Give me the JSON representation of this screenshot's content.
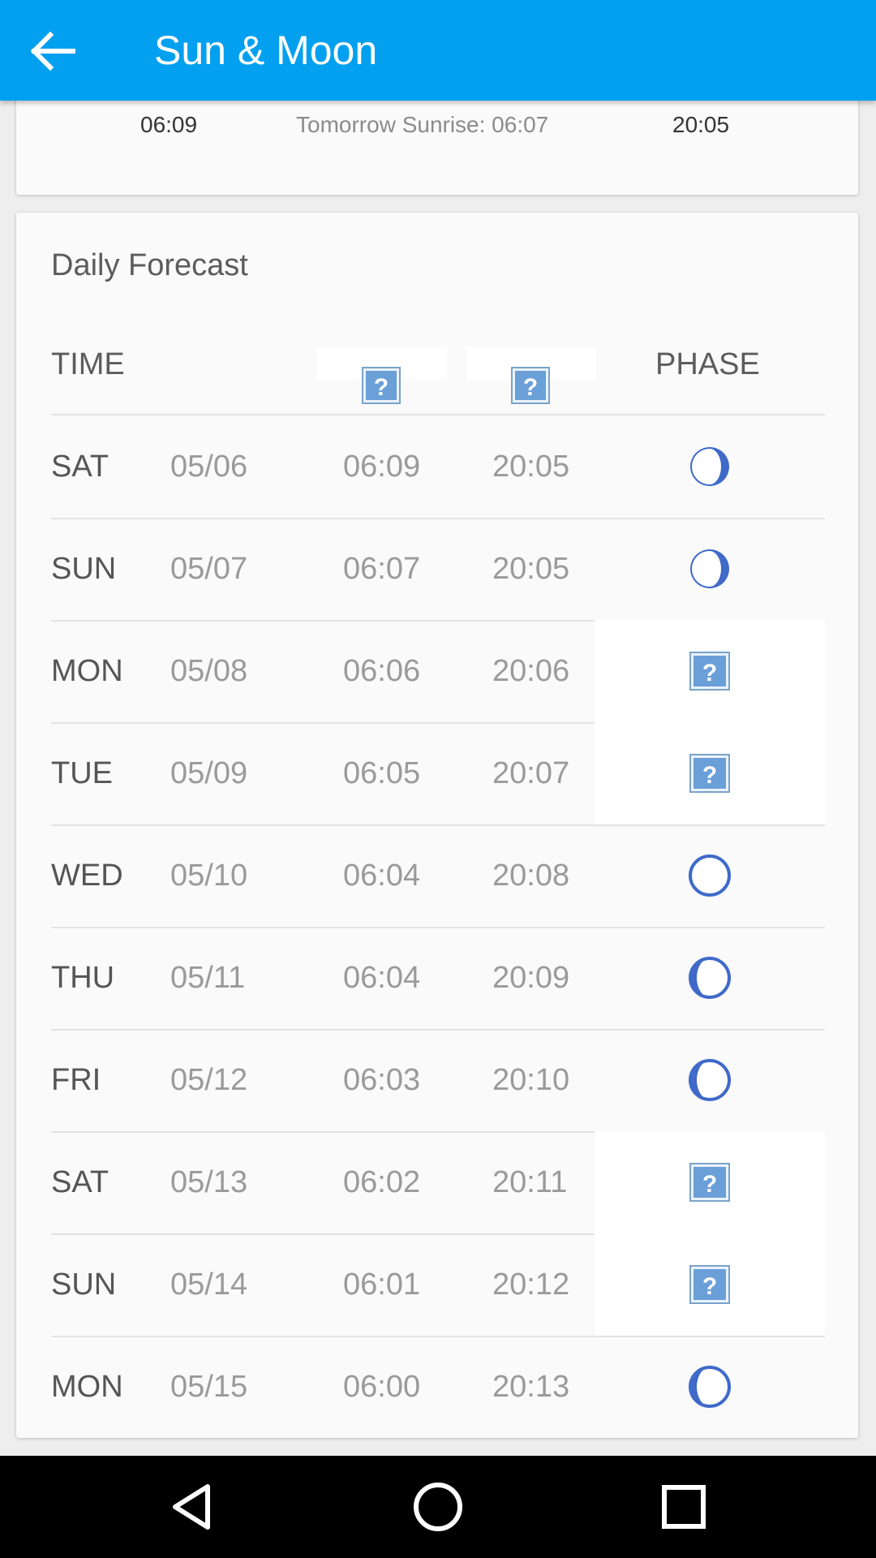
{
  "appbar": {
    "title": "Sun & Moon",
    "back_icon": "arrow-left-icon",
    "color": "#03a0ef"
  },
  "summary": {
    "sunrise": "06:09",
    "tomorrow": "Tomorrow Sunrise: 06:07",
    "sunset": "20:05"
  },
  "forecast": {
    "title": "Daily Forecast",
    "header": {
      "time": "TIME",
      "sunrise_icon": "missing-image-icon",
      "sunset_icon": "missing-image-icon",
      "phase": "PHASE"
    },
    "rows": [
      {
        "day": "SAT",
        "date": "05/06",
        "rise": "06:09",
        "set": "20:05",
        "phase": "waxing-crescent-icon"
      },
      {
        "day": "SUN",
        "date": "05/07",
        "rise": "06:07",
        "set": "20:05",
        "phase": "waxing-crescent-icon"
      },
      {
        "day": "MON",
        "date": "05/08",
        "rise": "06:06",
        "set": "20:06",
        "phase": "missing-image-icon"
      },
      {
        "day": "TUE",
        "date": "05/09",
        "rise": "06:05",
        "set": "20:07",
        "phase": "missing-image-icon"
      },
      {
        "day": "WED",
        "date": "05/10",
        "rise": "06:04",
        "set": "20:08",
        "phase": "full-moon-icon"
      },
      {
        "day": "THU",
        "date": "05/11",
        "rise": "06:04",
        "set": "20:09",
        "phase": "waning-gibbous-icon"
      },
      {
        "day": "FRI",
        "date": "05/12",
        "rise": "06:03",
        "set": "20:10",
        "phase": "waning-gibbous-icon"
      },
      {
        "day": "SAT",
        "date": "05/13",
        "rise": "06:02",
        "set": "20:11",
        "phase": "missing-image-icon"
      },
      {
        "day": "SUN",
        "date": "05/14",
        "rise": "06:01",
        "set": "20:12",
        "phase": "missing-image-icon"
      },
      {
        "day": "MON",
        "date": "05/15",
        "rise": "06:00",
        "set": "20:13",
        "phase": "waning-gibbous-icon"
      }
    ]
  },
  "navbar": {
    "back_icon": "nav-back-icon",
    "home_icon": "nav-home-icon",
    "recents_icon": "nav-recents-icon"
  },
  "colors": {
    "moon_blue": "#3f6ac9",
    "missing_icon_fill": "#6a9fd8"
  }
}
